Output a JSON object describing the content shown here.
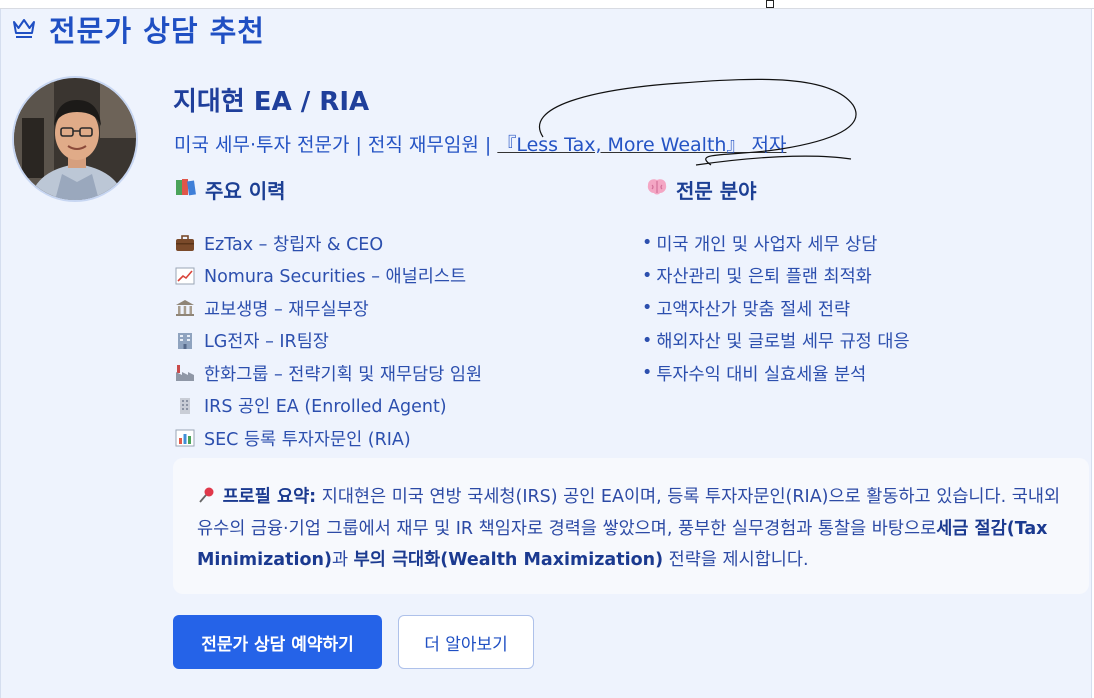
{
  "card": {
    "title": "전문가 상담 추천",
    "title_icon": "crown-icon"
  },
  "profile": {
    "name": "지대현 EA / RIA",
    "subtitle_prefix": "미국 세무·투자 전문가 | 전직 재무임원 | ",
    "book_title": "『Less Tax, More Wealth』 저자"
  },
  "career": {
    "heading": "주요 이력",
    "heading_icon": "books-icon",
    "items": [
      {
        "icon": "briefcase-icon",
        "text": "EzTax – 창립자 & CEO"
      },
      {
        "icon": "chart-increasing-icon",
        "text": "Nomura Securities – 애널리스트"
      },
      {
        "icon": "bank-icon",
        "text": "교보생명 – 재무실부장"
      },
      {
        "icon": "office-building-icon",
        "text": "LG전자 – IR팀장"
      },
      {
        "icon": "factory-icon",
        "text": "한화그룹 – 전략기획 및 재무담당 임원"
      },
      {
        "icon": "building-icon",
        "text": "IRS 공인 EA (Enrolled Agent)"
      },
      {
        "icon": "bar-chart-icon",
        "text": "SEC 등록 투자자문인 (RIA)"
      }
    ]
  },
  "expertise": {
    "heading": "전문 분야",
    "heading_icon": "brain-icon",
    "bullet": "•",
    "items": [
      "미국 개인 및 사업자 세무 상담",
      "자산관리 및 은퇴 플랜 최적화",
      "고액자산가 맞춤 절세 전략",
      "해외자산 및 글로벌 세무 규정 대응",
      "투자수익 대비 실효세율 분석"
    ]
  },
  "summary": {
    "icon": "pushpin-icon",
    "label": "프로필 요약:",
    "text_1": " 지대현은 미국 연방 국세청(IRS) 공인 EA이며, 등록 투자자문인(RIA)으로 활동하고 있습니다. 국내외 유수의 금융·기업 그룹에서 재무 및 IR 책임자로 경력을 쌓았으며, 풍부한 실무경험과 통찰을 바탕으로",
    "emph_1": "세금 절감(Tax Minimization)",
    "text_2": "과 ",
    "emph_2": "부의 극대화(Wealth Maximization)",
    "text_3": " 전략을 제시합니다."
  },
  "buttons": {
    "primary": "전문가 상담 예약하기",
    "secondary": "더 알아보기"
  },
  "colors": {
    "accent": "#2563e8",
    "title": "#1f4fc3",
    "card_bg": "#eef3fd",
    "text": "#2c4fae"
  }
}
